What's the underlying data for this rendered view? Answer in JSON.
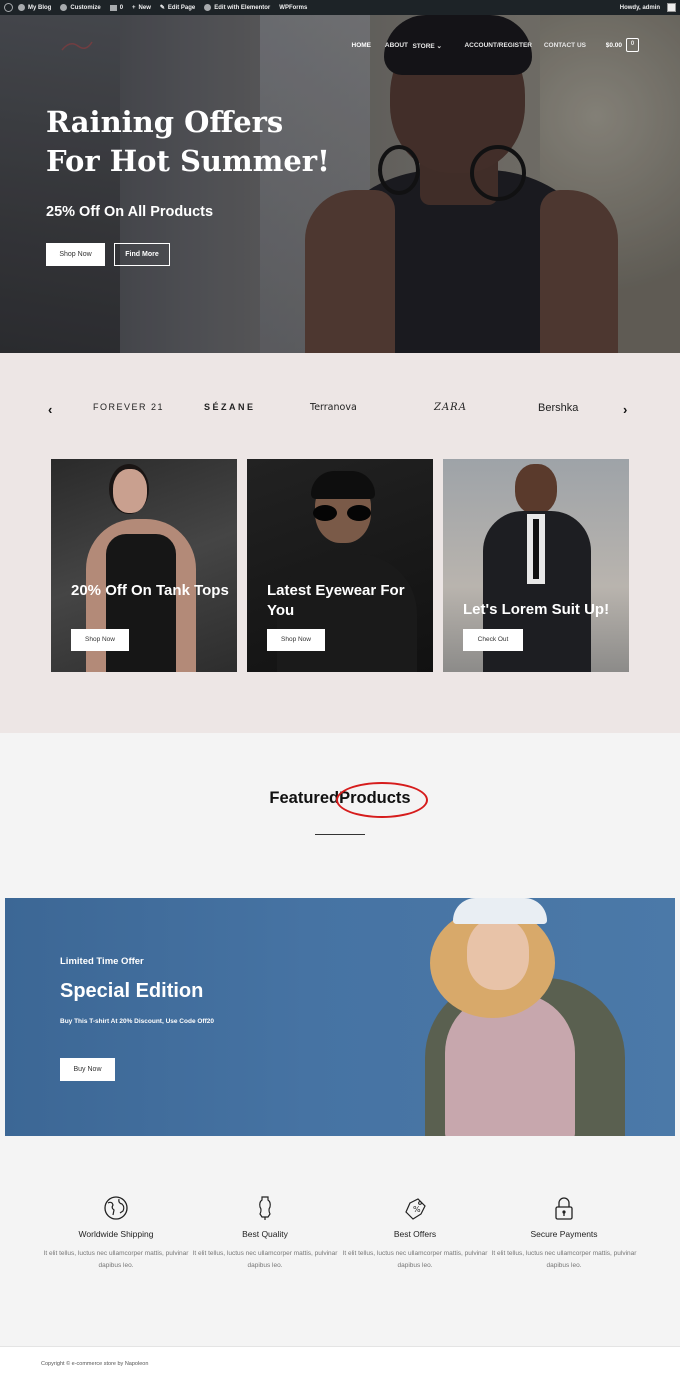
{
  "admin_bar": {
    "items": [
      "My Blog",
      "Customize",
      "0",
      "New",
      "Edit Page",
      "Edit with Elementor",
      "WPForms"
    ],
    "howdy": "Howdy, admin"
  },
  "nav": {
    "items": [
      "HOME",
      "ABOUT",
      "STORE",
      "ACCOUNT/REGISTER",
      "CONTACT US"
    ],
    "cart_total": "$0.00",
    "cart_count": "0"
  },
  "hero": {
    "title": "Raining Offers For Hot Summer!",
    "subtitle": "25% Off On All Products",
    "shop_button": "Shop Now",
    "find_button": "Find More"
  },
  "brands": [
    "FOREVER 21",
    "SÉZANE",
    "Terranova",
    "ZARA",
    "Bershka"
  ],
  "promos": [
    {
      "title": "20% Off On Tank Tops",
      "button": "Shop Now"
    },
    {
      "title": "Latest Eyewear For You",
      "button": "Shop Now"
    },
    {
      "title": "Let's Lorem Suit Up!",
      "button": "Check Out"
    }
  ],
  "featured": {
    "word1": "Featured",
    "word2": "Products"
  },
  "banner": {
    "label": "Limited Time Offer",
    "title": "Special Edition",
    "text": "Buy This T-shirt At 20% Discount, Use Code Off20",
    "button": "Buy Now"
  },
  "features": [
    {
      "icon": "globe-icon",
      "name": "Worldwide Shipping",
      "desc": "It elit tellus, luctus nec ullamcorper mattis, pulvinar dapibus leo."
    },
    {
      "icon": "dress-form-icon",
      "name": "Best Quality",
      "desc": "It elit tellus, luctus nec ullamcorper mattis, pulvinar dapibus leo."
    },
    {
      "icon": "price-tag-icon",
      "name": "Best Offers",
      "desc": "It elit tellus, luctus nec ullamcorper mattis, pulvinar dapibus leo."
    },
    {
      "icon": "lock-icon",
      "name": "Secure Payments",
      "desc": "It elit tellus, luctus nec ullamcorper mattis, pulvinar dapibus leo."
    }
  ],
  "footer": {
    "copyright": "Copyright © e-commerce store by Napoleon"
  }
}
